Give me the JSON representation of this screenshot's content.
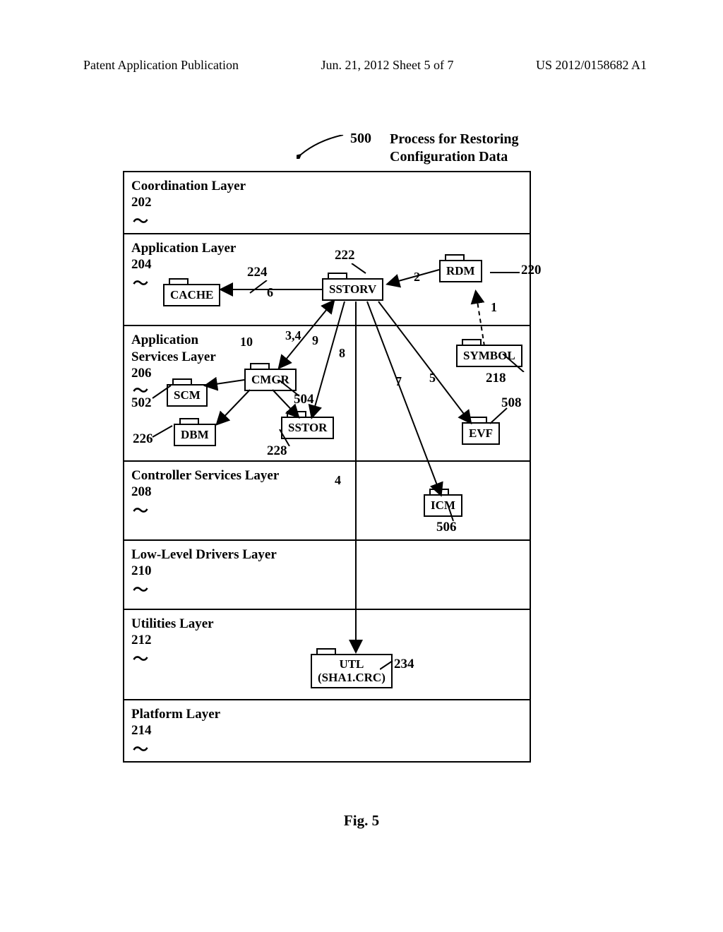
{
  "header": {
    "left": "Patent Application Publication",
    "center": "Jun. 21, 2012  Sheet 5 of 7",
    "right": "US 2012/0158682 A1"
  },
  "title": {
    "ref": "500",
    "text_line1": "Process for Restoring",
    "text_line2": "Configuration Data"
  },
  "layers": {
    "coord": {
      "title": "Coordination Layer",
      "ref": "202"
    },
    "app": {
      "title": "Application Layer",
      "ref": "204"
    },
    "asl": {
      "title_line1": "Application",
      "title_line2": "Services Layer",
      "ref": "206"
    },
    "csl": {
      "title": "Controller Services Layer",
      "ref": "208"
    },
    "lld": {
      "title": "Low-Level Drivers Layer",
      "ref": "210"
    },
    "utl": {
      "title": "Utilities Layer",
      "ref": "212"
    },
    "plat": {
      "title": "Platform Layer",
      "ref": "214"
    }
  },
  "blocks": {
    "cache": {
      "label": "CACHE",
      "ref": "224"
    },
    "sstorv": {
      "label": "SSTORV",
      "ref": "222"
    },
    "rdm": {
      "label": "RDM",
      "ref": "220"
    },
    "symbol": {
      "label": "SYMBOL",
      "ref": "218"
    },
    "scm": {
      "label": "SCM",
      "ref": "502"
    },
    "cmgr": {
      "label": "CMGR",
      "ref": "504"
    },
    "dbm": {
      "label": "DBM",
      "ref": "226"
    },
    "sstor": {
      "label": "SSTOR",
      "ref": "228"
    },
    "evf": {
      "label": "EVF",
      "ref": "508"
    },
    "icm": {
      "label": "ICM",
      "ref": "506"
    },
    "utl": {
      "label_line1": "UTL",
      "label_line2": "(SHA1.CRC)",
      "ref": "234"
    }
  },
  "steps": {
    "s1": "1",
    "s2": "2",
    "s34": "3,4",
    "s4": "4",
    "s5": "5",
    "s6": "6",
    "s7": "7",
    "s8": "8",
    "s9": "9",
    "s10": "10"
  },
  "figure_caption": "Fig. 5"
}
